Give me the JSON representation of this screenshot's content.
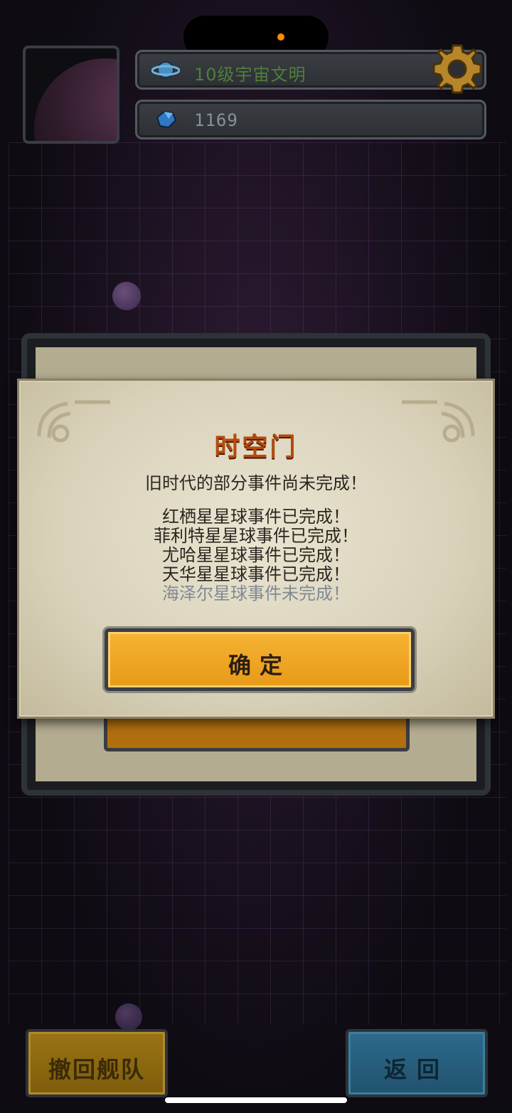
{
  "header": {
    "civilization_label": "10级宇宙文明",
    "crystal_count": "1169"
  },
  "icons": {
    "planet_ring": "planet-icon",
    "crystal": "crystal-icon",
    "settings": "gear-icon"
  },
  "dialog": {
    "title": "时空门",
    "subtitle": "旧时代的部分事件尚未完成！",
    "events": [
      {
        "text": "红栖星星球事件已完成！",
        "status": "complete"
      },
      {
        "text": "菲利特星星球事件已完成！",
        "status": "complete"
      },
      {
        "text": "尤哈星星球事件已完成！",
        "status": "complete"
      },
      {
        "text": "天华星星球事件已完成！",
        "status": "complete"
      },
      {
        "text": "海泽尔星球事件未完成！",
        "status": "incomplete"
      }
    ],
    "confirm_label": "确定"
  },
  "footer": {
    "recall_label": "撤回舰队",
    "back_label": "返回"
  },
  "colors": {
    "accent_orange": "#e79a16",
    "title_orange": "#b64a0e",
    "back_blue": "#2c6a8c",
    "civ_green": "#4f7f3a",
    "incomplete_gray": "#7f8a93"
  }
}
